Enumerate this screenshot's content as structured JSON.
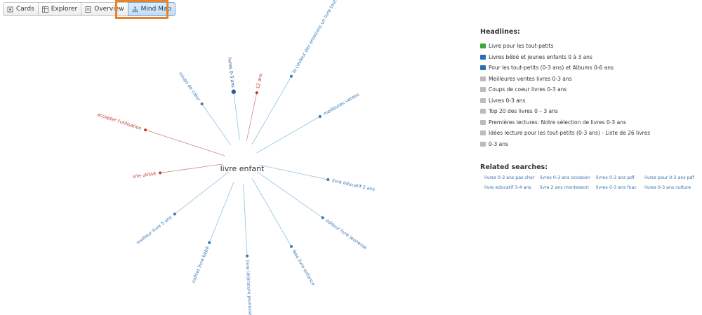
{
  "tabs": [
    {
      "label": "Cards",
      "icon": "cards-icon"
    },
    {
      "label": "Explorer",
      "icon": "table-icon"
    },
    {
      "label": "Overview",
      "icon": "document-icon"
    },
    {
      "label": "Mind Map",
      "icon": "mindmap-icon",
      "active": true
    }
  ],
  "mindmap": {
    "center": "livre enfant",
    "nodes": [
      {
        "label": "livres 0-3 ans",
        "color": "#2c5c9a"
      },
      {
        "label": "12 ans",
        "color": "#c0392b"
      },
      {
        "label": "la couleur des émotions un livre tout...",
        "color": "#3a78b5"
      },
      {
        "label": "meilleures ventes",
        "color": "#3a78b5"
      },
      {
        "label": "livre éducatif 2 ans",
        "color": "#3a78b5"
      },
      {
        "label": "éditeur livre jeunesse",
        "color": "#3a78b5"
      },
      {
        "label": "Ikea livre enfance",
        "color": "#3a78b5"
      },
      {
        "label": "livre littérature jeunesse",
        "color": "#3a78b5"
      },
      {
        "label": "coffret livre bébé",
        "color": "#3a78b5"
      },
      {
        "label": "meilleur livre 5 ans",
        "color": "#3a78b5"
      },
      {
        "label": "site utilisé",
        "color": "#c0392b"
      },
      {
        "label": "accepter l'utilisation",
        "color": "#c0392b"
      },
      {
        "label": "coups de cœur",
        "color": "#3a78b5"
      }
    ]
  },
  "headlines": {
    "title": "Headlines:",
    "items": [
      {
        "text": "Livre pour les tout-petits",
        "icon_color": "#3aa83a"
      },
      {
        "text": "Livres bébé et jeunes enfants 0 à 3 ans",
        "icon_color": "#2c6fb5"
      },
      {
        "text": "Pour les tout-petits (0-3 ans) et Albums 0-6 ans",
        "icon_color": "#2c6fb5"
      },
      {
        "text": "Meilleures ventes livres 0-3 ans",
        "icon_color": "#bbbbbb"
      },
      {
        "text": "Coups de coeur livres 0-3 ans",
        "icon_color": "#bbbbbb"
      },
      {
        "text": "Livres 0-3 ans",
        "icon_color": "#bbbbbb"
      },
      {
        "text": "Top 20 des livres 0 – 3 ans",
        "icon_color": "#bbbbbb"
      },
      {
        "text": "Premières lectures: Notre sélection de livres 0-3 ans",
        "icon_color": "#bbbbbb"
      },
      {
        "text": "Idées lecture pour les tout-petits (0-3 ans) - Liste de 26 livres",
        "icon_color": "#bbbbbb"
      },
      {
        "text": "0-3 ans",
        "icon_color": "#bbbbbb"
      }
    ]
  },
  "related": {
    "title": "Related searches:",
    "links": [
      "livres 0-3 ans pas cher",
      "livres 0-3 ans occasion",
      "livres 0-3 ans pdf",
      "livres pour 0-3 ans pdf",
      "livre educatif 3-4 ans",
      "livre 2 ans montessori",
      "livres 0-3 ans fnac",
      "livres 0-3 ans culture"
    ]
  }
}
